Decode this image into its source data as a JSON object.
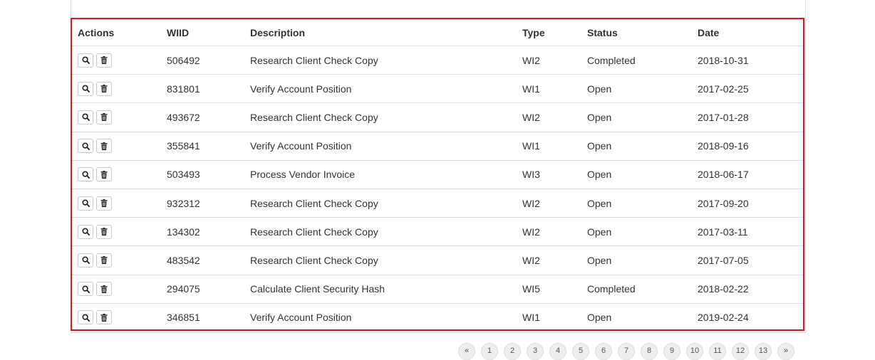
{
  "table": {
    "headers": {
      "actions": "Actions",
      "wiid": "WIID",
      "description": "Description",
      "type": "Type",
      "status": "Status",
      "date": "Date"
    },
    "rows": [
      {
        "wiid": "506492",
        "description": "Research Client Check Copy",
        "type": "WI2",
        "status": "Completed",
        "date": "2018-10-31"
      },
      {
        "wiid": "831801",
        "description": "Verify Account Position",
        "type": "WI1",
        "status": "Open",
        "date": "2017-02-25"
      },
      {
        "wiid": "493672",
        "description": "Research Client Check Copy",
        "type": "WI2",
        "status": "Open",
        "date": "2017-01-28"
      },
      {
        "wiid": "355841",
        "description": "Verify Account Position",
        "type": "WI1",
        "status": "Open",
        "date": "2018-09-16"
      },
      {
        "wiid": "503493",
        "description": "Process Vendor Invoice",
        "type": "WI3",
        "status": "Open",
        "date": "2018-06-17"
      },
      {
        "wiid": "932312",
        "description": "Research Client Check Copy",
        "type": "WI2",
        "status": "Open",
        "date": "2017-09-20"
      },
      {
        "wiid": "134302",
        "description": "Research Client Check Copy",
        "type": "WI2",
        "status": "Open",
        "date": "2017-03-11"
      },
      {
        "wiid": "483542",
        "description": "Research Client Check Copy",
        "type": "WI2",
        "status": "Open",
        "date": "2017-07-05"
      },
      {
        "wiid": "294075",
        "description": "Calculate Client Security Hash",
        "type": "WI5",
        "status": "Completed",
        "date": "2018-02-22"
      },
      {
        "wiid": "346851",
        "description": "Verify Account Position",
        "type": "WI1",
        "status": "Open",
        "date": "2019-02-24"
      }
    ],
    "row_icons": [
      "search-icon",
      "trash-icon"
    ]
  },
  "pagination": {
    "pages": [
      "«",
      "1",
      "2",
      "3",
      "4",
      "5",
      "6",
      "7",
      "8",
      "9",
      "10",
      "11",
      "12",
      "13",
      "»"
    ]
  },
  "colors": {
    "highlight_border": "#e0141b",
    "row_border": "#dddddd",
    "text": "#333333"
  }
}
